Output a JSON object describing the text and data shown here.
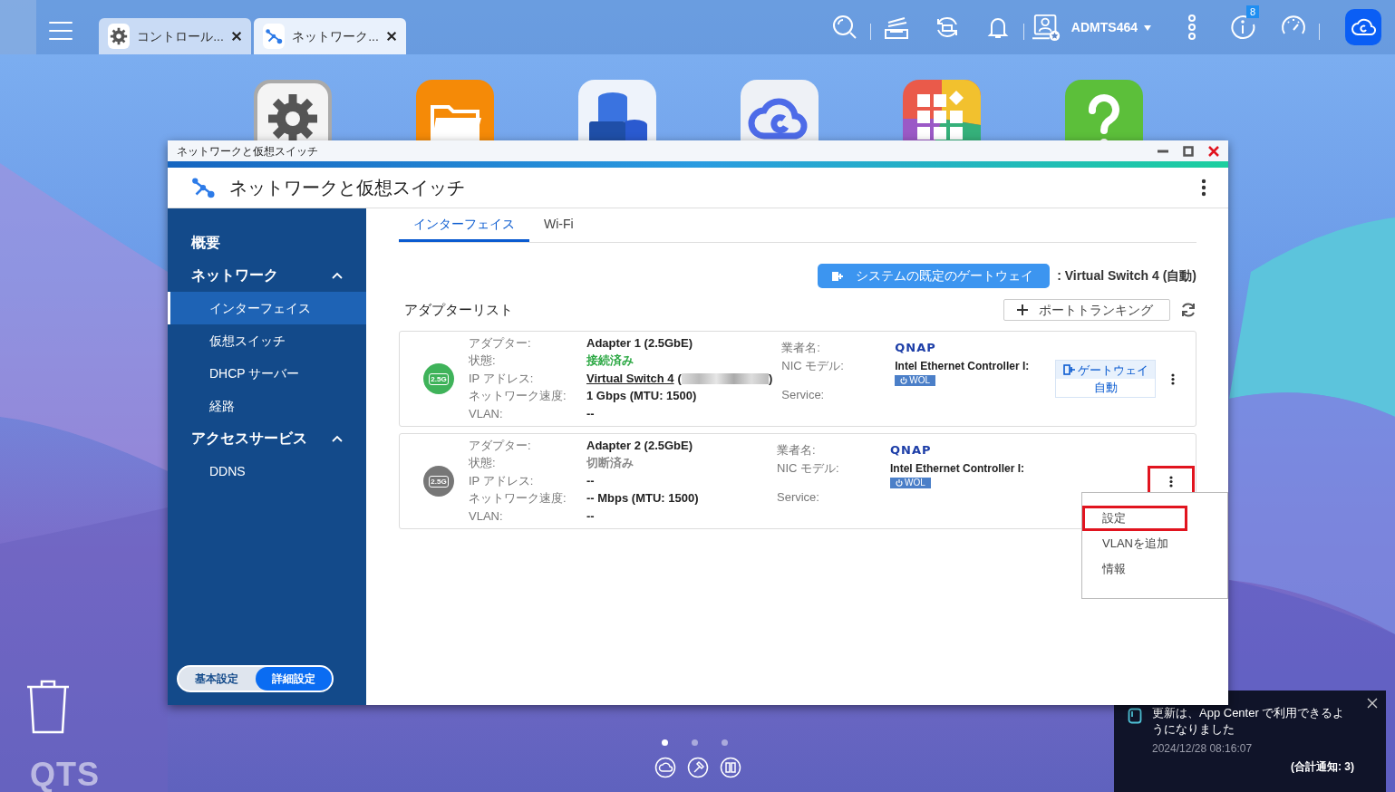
{
  "top_bar": {
    "tabs": [
      {
        "label": "コントロール...",
        "selected": false,
        "kind": "settings"
      },
      {
        "label": "ネットワーク...",
        "selected": true,
        "kind": "network"
      }
    ],
    "user": "ADMTS464",
    "info_badge": "8"
  },
  "desktop_icons": [
    {
      "kind": "settings"
    },
    {
      "kind": "folder"
    },
    {
      "kind": "storage"
    },
    {
      "kind": "cloud"
    },
    {
      "kind": "apps"
    },
    {
      "kind": "help"
    }
  ],
  "window": {
    "caption": "ネットワークと仮想スイッチ",
    "title": "ネットワークと仮想スイッチ"
  },
  "sidebar": {
    "items": [
      {
        "label": "概要",
        "selected": false
      },
      {
        "label": "ネットワーク",
        "selected": false,
        "expanded": true,
        "children": [
          {
            "label": "インターフェイス",
            "selected": true
          },
          {
            "label": "仮想スイッチ",
            "selected": false
          },
          {
            "label": "DHCP サーバー",
            "selected": false
          },
          {
            "label": "経路",
            "selected": false
          }
        ]
      },
      {
        "label": "アクセスサービス",
        "selected": false,
        "expanded": true,
        "children": [
          {
            "label": "DDNS",
            "selected": false
          }
        ]
      }
    ],
    "mode_toggle": [
      {
        "label": "基本設定",
        "selected": false
      },
      {
        "label": "詳細設定",
        "selected": true
      }
    ]
  },
  "tabs": [
    {
      "label": "インターフェイス",
      "selected": true
    },
    {
      "label": "Wi-Fi",
      "selected": false
    }
  ],
  "gateway": {
    "button": "システムの既定のゲートウェイ",
    "value": ": Virtual Switch 4 (自動)"
  },
  "adapter_list": {
    "title": "アダプターリスト",
    "trunking_button": "ポートトランキング"
  },
  "adapters": [
    {
      "icon_label": "2.5G",
      "connected": true,
      "menu_highlighted": false,
      "fields": [
        {
          "label": "アダプター:",
          "value": "Adapter 1 (2.5GbE)",
          "kind": "text"
        },
        {
          "label": "状態:",
          "value": "接続済み",
          "kind": "status"
        },
        {
          "label": "IP アドレス:",
          "value": "Virtual Switch 4",
          "open": "(",
          "close": ")",
          "kind": "link"
        },
        {
          "label": "ネットワーク速度:",
          "value": "1 Gbps (MTU: 1500)",
          "kind": "text"
        },
        {
          "label": "VLAN:",
          "value": "--",
          "kind": "text"
        }
      ],
      "vendor": {
        "labels": [
          "業者名:",
          "NIC モデル:",
          "Service:"
        ],
        "logo": "QNAP",
        "model": "Intel Ethernet Controller I:",
        "service": "WOL"
      },
      "gateway_tag": {
        "title": "ゲートウェイ",
        "mode": "自動"
      }
    },
    {
      "icon_label": "2.5G",
      "connected": false,
      "menu_highlighted": true,
      "fields": [
        {
          "label": "アダプター:",
          "value": "Adapter 2 (2.5GbE)",
          "kind": "text"
        },
        {
          "label": "状態:",
          "value": "切断済み",
          "kind": "status"
        },
        {
          "label": "IP アドレス:",
          "value": "--",
          "kind": "text"
        },
        {
          "label": "ネットワーク速度:",
          "value": "-- Mbps (MTU: 1500)",
          "kind": "text"
        },
        {
          "label": "VLAN:",
          "value": "--",
          "kind": "text"
        }
      ],
      "vendor": {
        "labels": [
          "業者名:",
          "NIC モデル:",
          "Service:"
        ],
        "logo": "QNAP",
        "model": "Intel Ethernet Controller I:",
        "service": "WOL"
      }
    }
  ],
  "context_menu": {
    "items": [
      {
        "label": "設定",
        "highlighted": true
      },
      {
        "label": "VLANを追加",
        "highlighted": false
      },
      {
        "label": "情報",
        "highlighted": false
      }
    ]
  },
  "notification": {
    "message": "更新は、App Center で利用できるようになりました",
    "time": "2024/12/28 08:16:07",
    "total": "(合計通知: 3)"
  },
  "desktop": {
    "logo": "QTS",
    "pages": [
      {
        "selected": true
      },
      {
        "selected": false
      },
      {
        "selected": false
      }
    ]
  }
}
